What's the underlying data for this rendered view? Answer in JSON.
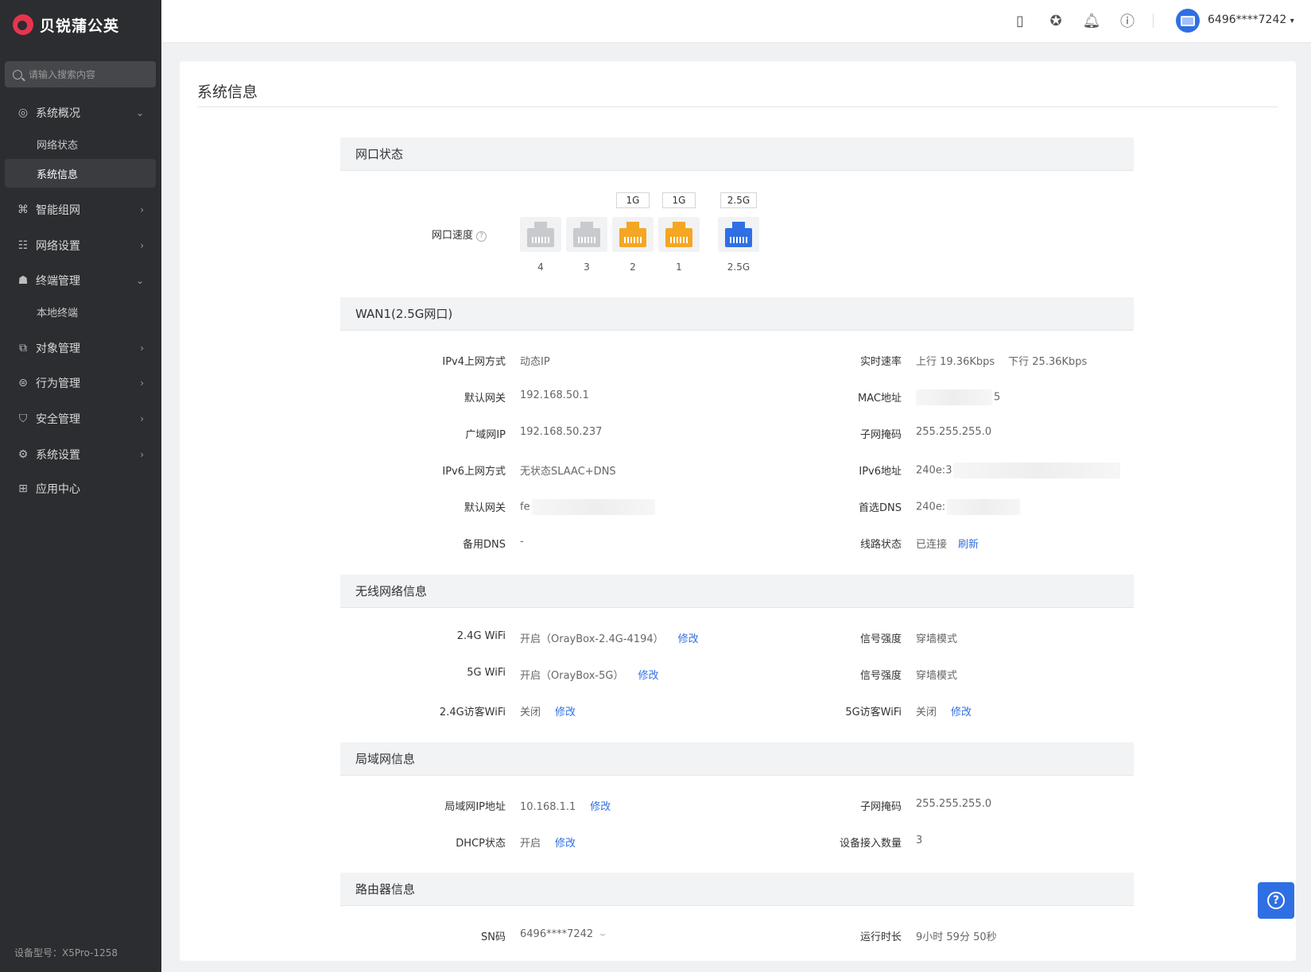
{
  "brand": {
    "name": "贝锐蒲公英"
  },
  "search": {
    "placeholder": "请输入搜索内容"
  },
  "sidebar": {
    "items": [
      {
        "label": "系统概况",
        "icon": "globe-icon",
        "chevron": "down"
      },
      {
        "label": "网络状态",
        "sub": true
      },
      {
        "label": "系统信息",
        "sub": true,
        "active": true
      },
      {
        "label": "智能组网",
        "icon": "network-icon",
        "chevron": "right"
      },
      {
        "label": "网络设置",
        "icon": "sliders-icon",
        "chevron": "right"
      },
      {
        "label": "终端管理",
        "icon": "terminal-user-icon",
        "chevron": "down"
      },
      {
        "label": "本地终端",
        "sub": true
      },
      {
        "label": "对象管理",
        "icon": "object-icon",
        "chevron": "right"
      },
      {
        "label": "行为管理",
        "icon": "behavior-icon",
        "chevron": "right"
      },
      {
        "label": "安全管理",
        "icon": "shield-icon",
        "chevron": "right"
      },
      {
        "label": "系统设置",
        "icon": "gear-icon",
        "chevron": "right"
      },
      {
        "label": "应用中心",
        "icon": "apps-icon"
      }
    ],
    "device_model": "设备型号：X5Pro-1258"
  },
  "header": {
    "account": "6496****7242"
  },
  "page": {
    "title": "系统信息"
  },
  "ports": {
    "title": "网口状态",
    "label": "网口速度",
    "list": [
      {
        "num": "4",
        "speed": "",
        "state": "idle"
      },
      {
        "num": "3",
        "speed": "",
        "state": "idle"
      },
      {
        "num": "2",
        "speed": "1G",
        "state": "lan"
      },
      {
        "num": "1",
        "speed": "1G",
        "state": "lan"
      },
      {
        "num": "2.5G",
        "speed": "2.5G",
        "state": "wan"
      }
    ],
    "colors": {
      "idle": "#c9cacd",
      "lan": "#f5a623",
      "wan": "#2f6fe4"
    }
  },
  "wan": {
    "title": "WAN1(2.5G网口)",
    "left": [
      {
        "label": "IPv4上网方式",
        "value": "动态IP"
      },
      {
        "label": "默认网关",
        "value": "192.168.50.1"
      },
      {
        "label": "广域网IP",
        "value": "192.168.50.237"
      },
      {
        "label": "IPv6上网方式",
        "value": "无状态SLAAC+DNS"
      },
      {
        "label": "默认网关",
        "value": "fe"
      },
      {
        "label": "备用DNS",
        "value": "-"
      }
    ],
    "right": [
      {
        "label": "实时速率",
        "up": "上行 19.36Kbps",
        "down": "下行 25.36Kbps"
      },
      {
        "label": "MAC地址",
        "value": "5"
      },
      {
        "label": "子网掩码",
        "value": "255.255.255.0"
      },
      {
        "label": "IPv6地址",
        "value": "240e:3"
      },
      {
        "label": "首选DNS",
        "value": "240e:"
      },
      {
        "label": "线路状态",
        "value": "已连接",
        "action": "刷新"
      }
    ]
  },
  "wireless": {
    "title": "无线网络信息",
    "left": [
      {
        "label": "2.4G WiFi",
        "value": "开启（OrayBox-2.4G-4194）",
        "action": "修改"
      },
      {
        "label": "5G WiFi",
        "value": "开启（OrayBox-5G）",
        "action": "修改"
      },
      {
        "label": "2.4G访客WiFi",
        "value": "关闭",
        "action": "修改"
      }
    ],
    "right": [
      {
        "label": "信号强度",
        "value": "穿墙模式"
      },
      {
        "label": "信号强度",
        "value": "穿墙模式"
      },
      {
        "label": "5G访客WiFi",
        "value": "关闭",
        "action": "修改"
      }
    ]
  },
  "lan": {
    "title": "局域网信息",
    "left": [
      {
        "label": "局域网IP地址",
        "value": "10.168.1.1",
        "action": "修改"
      },
      {
        "label": "DHCP状态",
        "value": "开启",
        "action": "修改"
      }
    ],
    "right": [
      {
        "label": "子网掩码",
        "value": "255.255.255.0"
      },
      {
        "label": "设备接入数量",
        "value": "3"
      }
    ]
  },
  "router": {
    "title": "路由器信息",
    "sn_label": "SN码",
    "sn_value": "6496****7242",
    "uptime_label": "运行时长",
    "uptime_value": "9小时 59分 50秒"
  },
  "accent": "#2f6fe4"
}
